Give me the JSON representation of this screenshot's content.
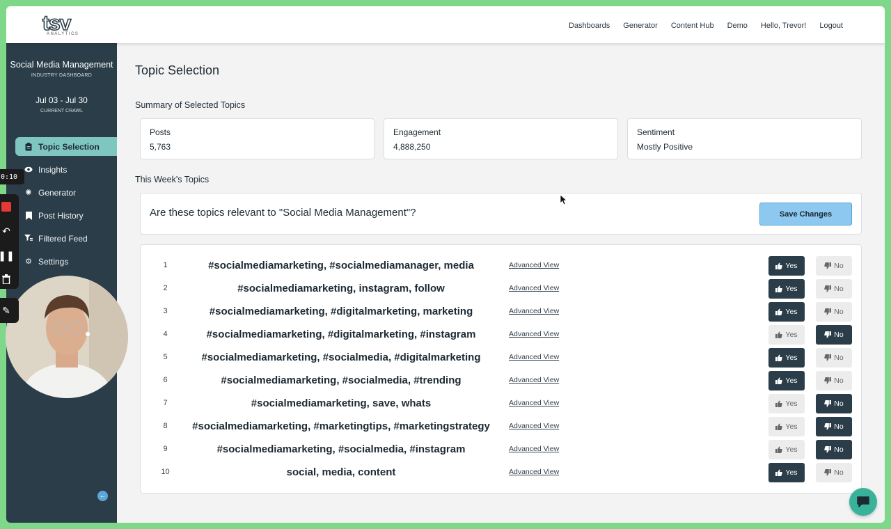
{
  "header": {
    "logo_text": "tsv",
    "logo_sub": "ANALYTICS",
    "nav": [
      "Dashboards",
      "Generator",
      "Content Hub",
      "Demo",
      "Hello, Trevor!",
      "Logout"
    ]
  },
  "sidebar": {
    "title": "Social Media Management",
    "subtitle": "INDUSTRY DASHBOARD",
    "date_range": "Jul 03 - Jul 30",
    "date_sub": "CURRENT CRAWL",
    "items": [
      {
        "label": "Topic Selection",
        "icon": "clipboard-icon",
        "active": true
      },
      {
        "label": "Insights",
        "icon": "eye-icon",
        "active": false
      },
      {
        "label": "Generator",
        "icon": "gear-icon",
        "active": false
      },
      {
        "label": "Post History",
        "icon": "bookmark-icon",
        "active": false
      },
      {
        "label": "Filtered Feed",
        "icon": "filter-icon",
        "active": false
      },
      {
        "label": "Settings",
        "icon": "settings-icon",
        "active": false
      }
    ]
  },
  "recorder": {
    "time": "0:10"
  },
  "main": {
    "title": "Topic Selection",
    "summary_label": "Summary of Selected Topics",
    "cards": [
      {
        "label": "Posts",
        "value": "5,763"
      },
      {
        "label": "Engagement",
        "value": "4,888,250"
      },
      {
        "label": "Sentiment",
        "value": "Mostly Positive"
      }
    ],
    "week_label": "This Week's Topics",
    "question": "Are these topics relevant to \"Social Media Management\"?",
    "save_label": "Save Changes",
    "yes_label": "Yes",
    "no_label": "No",
    "advanced_label": "Advanced View",
    "topics": [
      {
        "num": "1",
        "text": "#socialmediamarketing, #socialmediamanager, media",
        "selected": "yes"
      },
      {
        "num": "2",
        "text": "#socialmediamarketing, instagram, follow",
        "selected": "yes"
      },
      {
        "num": "3",
        "text": "#socialmediamarketing, #digitalmarketing, marketing",
        "selected": "yes"
      },
      {
        "num": "4",
        "text": "#socialmediamarketing, #digitalmarketing, #instagram",
        "selected": "no"
      },
      {
        "num": "5",
        "text": "#socialmediamarketing, #socialmedia, #digitalmarketing",
        "selected": "yes"
      },
      {
        "num": "6",
        "text": "#socialmediamarketing, #socialmedia, #trending",
        "selected": "yes"
      },
      {
        "num": "7",
        "text": "#socialmediamarketing, save, whats",
        "selected": "no"
      },
      {
        "num": "8",
        "text": "#socialmediamarketing, #marketingtips, #marketingstrategy",
        "selected": "no"
      },
      {
        "num": "9",
        "text": "#socialmediamarketing, #socialmedia, #instagram",
        "selected": "no"
      },
      {
        "num": "10",
        "text": "social, media, content",
        "selected": "yes"
      }
    ]
  },
  "colors": {
    "sidebar": "#2b3d48",
    "active_item": "#7fc6c0",
    "save_button": "#8cc8f0",
    "frame": "#7fd88a"
  }
}
